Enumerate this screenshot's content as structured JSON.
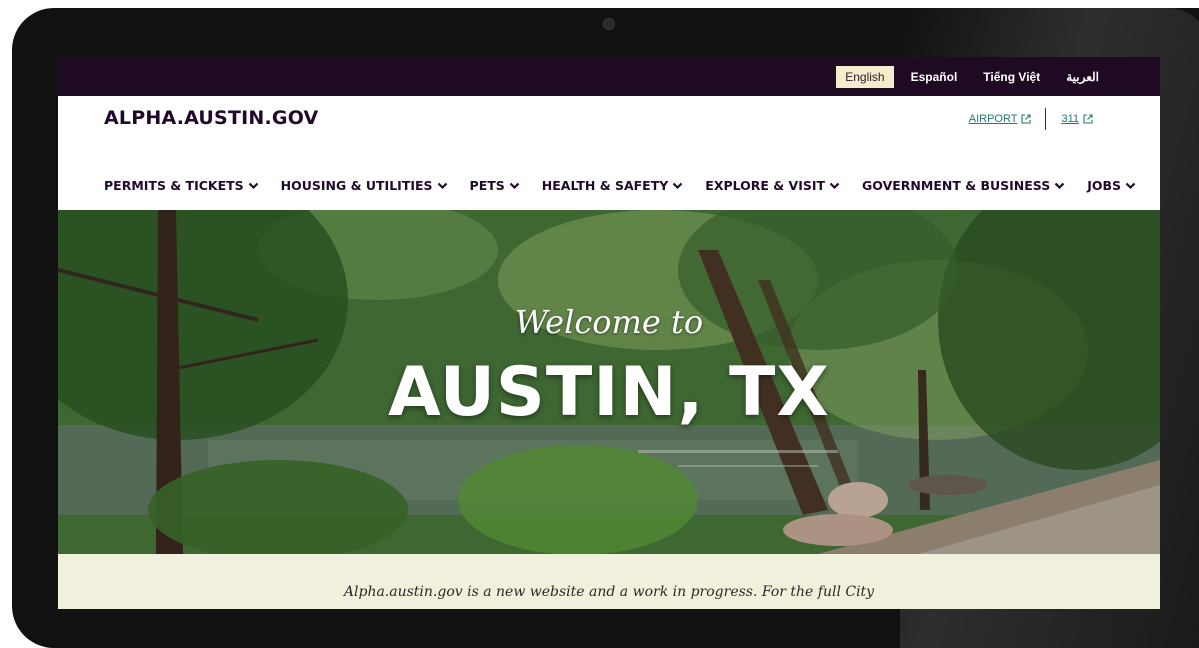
{
  "languages": [
    {
      "label": "English",
      "active": true
    },
    {
      "label": "Español",
      "active": false
    },
    {
      "label": "Tiếng Việt",
      "active": false
    },
    {
      "label": "العربية",
      "active": false
    }
  ],
  "header": {
    "logo": "ALPHA.AUSTIN.GOV",
    "links": [
      {
        "label": "AIRPORT",
        "icon": "external-link-icon"
      },
      {
        "label": "311",
        "icon": "external-link-icon"
      }
    ]
  },
  "nav": {
    "items": [
      {
        "label": "PERMITS & TICKETS",
        "icon": "chevron-down-icon"
      },
      {
        "label": "HOUSING & UTILITIES",
        "icon": "chevron-down-icon"
      },
      {
        "label": "PETS",
        "icon": "chevron-down-icon"
      },
      {
        "label": "HEALTH & SAFETY",
        "icon": "chevron-down-icon"
      },
      {
        "label": "EXPLORE & VISIT",
        "icon": "chevron-down-icon"
      },
      {
        "label": "GOVERNMENT & BUSINESS",
        "icon": "chevron-down-icon"
      },
      {
        "label": "JOBS",
        "icon": "chevron-down-icon"
      }
    ]
  },
  "hero": {
    "welcome": "Welcome to",
    "city": "AUSTIN, TX"
  },
  "notice": {
    "text": "Alpha.austin.gov is a new website and a work in progress. For the full City"
  },
  "colors": {
    "top_bar": "#1e0a23",
    "brand_text": "#22092b",
    "link": "#1f7a72",
    "active_language_bg": "#f4eecd",
    "notice_bg": "#f1f0dc"
  }
}
